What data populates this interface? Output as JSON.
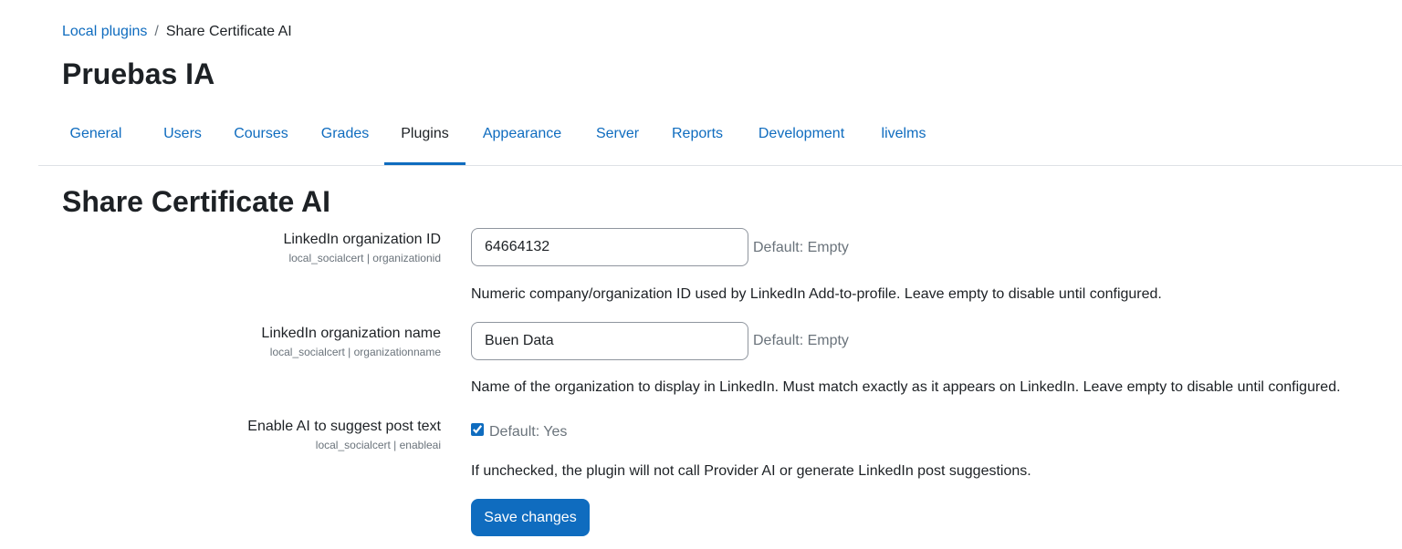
{
  "breadcrumb": {
    "parent": "Local plugins",
    "separator": "/",
    "current": "Share Certificate AI"
  },
  "page": {
    "title": "Pruebas IA"
  },
  "tabs": [
    {
      "label": "General",
      "active": false
    },
    {
      "label": "Users",
      "active": false
    },
    {
      "label": "Courses",
      "active": false
    },
    {
      "label": "Grades",
      "active": false
    },
    {
      "label": "Plugins",
      "active": true
    },
    {
      "label": "Appearance",
      "active": false
    },
    {
      "label": "Server",
      "active": false
    },
    {
      "label": "Reports",
      "active": false
    },
    {
      "label": "Development",
      "active": false
    },
    {
      "label": "livelms",
      "active": false
    }
  ],
  "section": {
    "title": "Share Certificate AI"
  },
  "settings": {
    "org_id": {
      "label": "LinkedIn organization ID",
      "key": "local_socialcert | organizationid",
      "value": "64664132",
      "default": "Default: Empty",
      "description": "Numeric company/organization ID used by LinkedIn Add-to-profile. Leave empty to disable until configured."
    },
    "org_name": {
      "label": "LinkedIn organization name",
      "key": "local_socialcert | organizationname",
      "value": "Buen Data",
      "default": "Default: Empty",
      "description": "Name of the organization to display in LinkedIn. Must match exactly as it appears on LinkedIn. Leave empty to disable until configured."
    },
    "enable_ai": {
      "label": "Enable AI to suggest post text",
      "key": "local_socialcert | enableai",
      "checked": true,
      "default": "Default: Yes",
      "description": "If unchecked, the plugin will not call Provider AI or generate LinkedIn post suggestions."
    }
  },
  "actions": {
    "save_label": "Save changes"
  },
  "colors": {
    "accent": "#0f6cbf",
    "text": "#1d2125",
    "muted": "#6a737b",
    "border": "#dee2e6"
  }
}
